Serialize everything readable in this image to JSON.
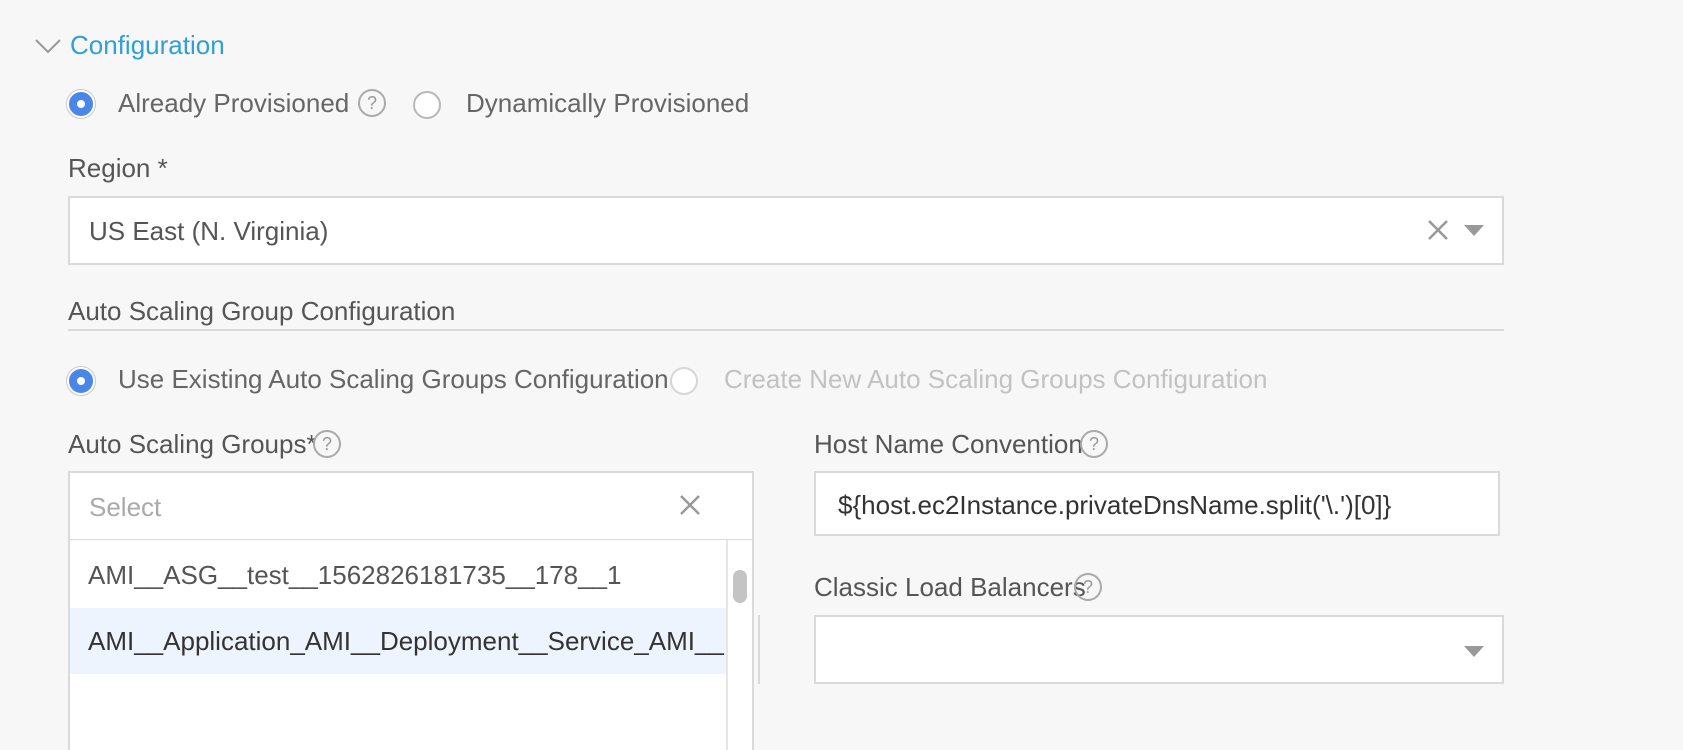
{
  "section": {
    "title": "Configuration"
  },
  "provision": {
    "already_label": "Already Provisioned",
    "dynamic_label": "Dynamically Provisioned",
    "selected": "already"
  },
  "region": {
    "label": "Region *",
    "value": "US East (N. Virginia)"
  },
  "asg_config": {
    "heading": "Auto Scaling Group Configuration",
    "use_existing_label": "Use Existing Auto Scaling Groups Configuration",
    "create_new_label": "Create New Auto Scaling Groups Configuration"
  },
  "asg": {
    "label": "Auto Scaling Groups*",
    "placeholder": "Select",
    "options": [
      "AMI__ASG__test__1562826181735__178__1",
      "AMI__Application_AMI__Deployment__Service_AMI__Env_"
    ]
  },
  "host_name": {
    "label": "Host Name Convention",
    "value": "${host.ec2Instance.privateDnsName.split('\\.')[0]}"
  },
  "clb": {
    "label": "Classic Load Balancers",
    "value": ""
  },
  "colors": {
    "accent": "#2ea0d8",
    "radio": "#4a86e8"
  },
  "icons": [
    "chevron-down-icon",
    "help-icon",
    "clear-icon",
    "caret-down-icon"
  ]
}
